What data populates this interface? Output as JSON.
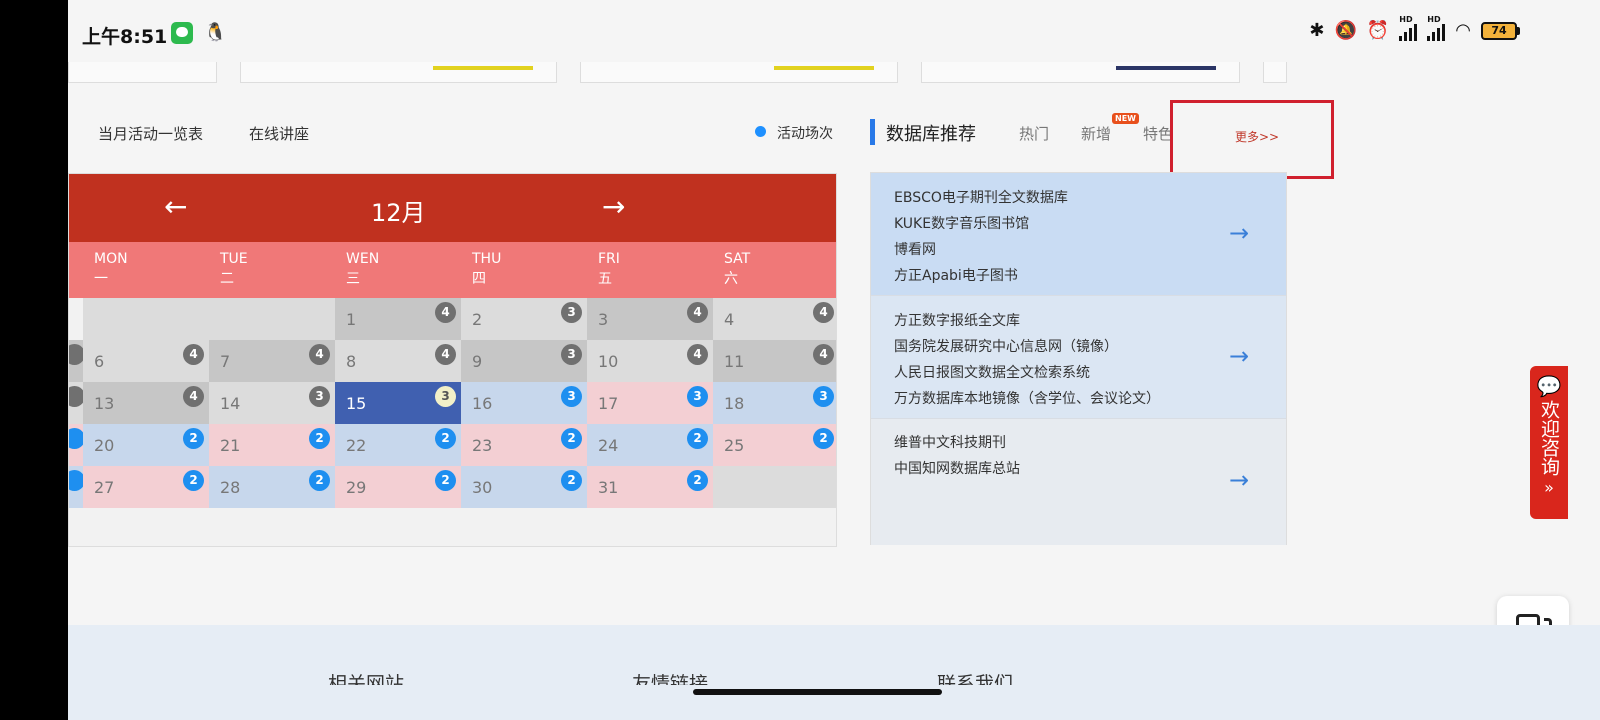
{
  "status_bar": {
    "time": "上午8:51",
    "battery": "74",
    "hd1": "HD",
    "hd2": "HD"
  },
  "nav": {
    "monthly_list": "当月活动一览表",
    "online_lecture": "在线讲座",
    "legend": "活动场次"
  },
  "db": {
    "title": "数据库推荐",
    "tabs": [
      "热门",
      "新增",
      "特色"
    ],
    "new_badge": "NEW",
    "more": "更多>>",
    "groups": [
      [
        "EBSCO电子期刊全文数据库",
        "KUKE数字音乐图书馆",
        "博看网",
        "方正Apabi电子图书"
      ],
      [
        "方正数字报纸全文库",
        "国务院发展研究中心信息网（镜像）",
        "人民日报图文数据全文检索系统",
        "万方数据库本地镜像（含学位、会议论文）"
      ],
      [
        "维普中文科技期刊",
        "中国知网数据库总站"
      ]
    ]
  },
  "calendar": {
    "month": "12月",
    "weekdays": [
      {
        "en": "MON",
        "cn": "一"
      },
      {
        "en": "TUE",
        "cn": "二"
      },
      {
        "en": "WEN",
        "cn": "三"
      },
      {
        "en": "THU",
        "cn": "四"
      },
      {
        "en": "FRI",
        "cn": "五"
      },
      {
        "en": "SAT",
        "cn": "六"
      }
    ],
    "days": [
      {
        "day": "1",
        "count": "4"
      },
      {
        "day": "2",
        "count": "3"
      },
      {
        "day": "3",
        "count": "4"
      },
      {
        "day": "4",
        "count": "4"
      },
      {
        "day": "6",
        "count": "4"
      },
      {
        "day": "7",
        "count": "4"
      },
      {
        "day": "8",
        "count": "4"
      },
      {
        "day": "9",
        "count": "3"
      },
      {
        "day": "10",
        "count": "4"
      },
      {
        "day": "11",
        "count": "4"
      },
      {
        "day": "13",
        "count": "4"
      },
      {
        "day": "14",
        "count": "3"
      },
      {
        "day": "15",
        "count": "3"
      },
      {
        "day": "16",
        "count": "3"
      },
      {
        "day": "17",
        "count": "3"
      },
      {
        "day": "18",
        "count": "3"
      },
      {
        "day": "20",
        "count": "2"
      },
      {
        "day": "21",
        "count": "2"
      },
      {
        "day": "22",
        "count": "2"
      },
      {
        "day": "23",
        "count": "2"
      },
      {
        "day": "24",
        "count": "2"
      },
      {
        "day": "25",
        "count": "2"
      },
      {
        "day": "27",
        "count": "2"
      },
      {
        "day": "28",
        "count": "2"
      },
      {
        "day": "29",
        "count": "2"
      },
      {
        "day": "30",
        "count": "2"
      },
      {
        "day": "31",
        "count": "2"
      }
    ]
  },
  "consult": {
    "label": "欢迎咨询",
    "chevron": "»"
  },
  "footer": {
    "sections": [
      "相关网站",
      "友情链接",
      "联系我们"
    ]
  },
  "icons": {
    "prev": "←",
    "next": "→",
    "db_arrow": "→"
  },
  "colors": {
    "calendar_header": "#c0311f",
    "weekday_row": "#f07878",
    "today": "#4060b0",
    "highlight_box": "#d0202e",
    "db_accent": "#2979e8"
  }
}
